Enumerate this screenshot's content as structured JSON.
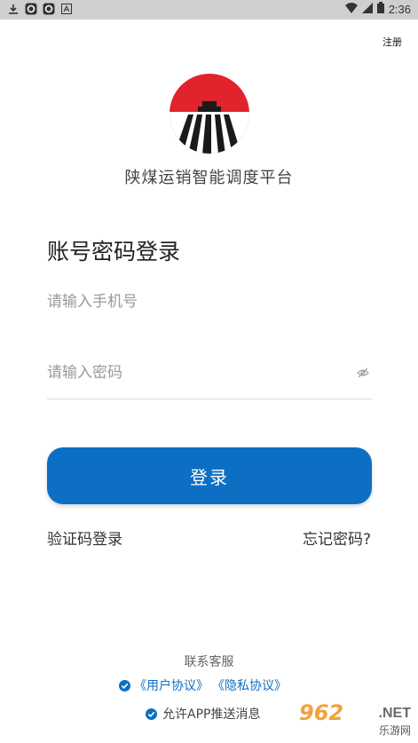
{
  "status_bar": {
    "time": "2:36",
    "icons_left": [
      "download-icon",
      "sync-icon",
      "sync-icon",
      "a-icon"
    ],
    "icons_right": [
      "wifi-icon",
      "signal-icon",
      "battery-icon"
    ]
  },
  "header": {
    "register_label": "注册"
  },
  "brand": {
    "app_title": "陕煤运销智能调度平台",
    "logo_color": "#e0232d"
  },
  "login": {
    "heading": "账号密码登录",
    "phone_placeholder": "请输入手机号",
    "password_placeholder": "请输入密码",
    "submit_label": "登录",
    "sms_login_label": "验证码登录",
    "forgot_password_label": "忘记密码?"
  },
  "footer": {
    "contact_label": "联系客服",
    "user_agreement": "《用户协议》",
    "privacy_agreement": "《隐私协议》",
    "push_label": "允许APP推送消息"
  },
  "watermark": {
    "main": "962",
    "net": ".NET",
    "sub": "乐游网"
  },
  "colors": {
    "primary": "#0d6fc3",
    "status_bar": "#cfcfcf"
  }
}
